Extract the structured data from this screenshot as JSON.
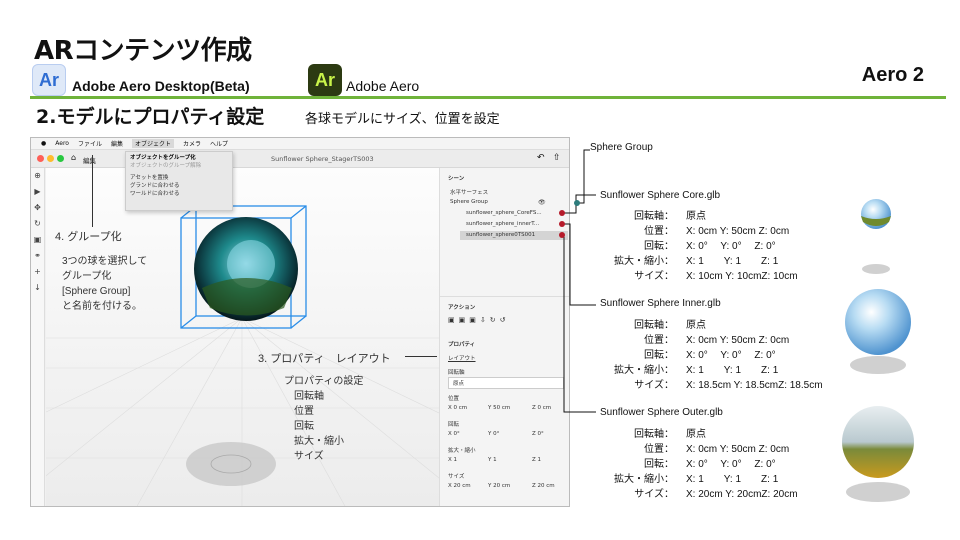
{
  "header": {
    "title": "ARコンテンツ作成",
    "app1_logo": "Ar",
    "app1_name": "Adobe Aero Desktop(Beta)",
    "app2_logo": "Ar",
    "app2_name": "Adobe Aero",
    "badge": "Aero 2",
    "accent": "#6fb33a"
  },
  "section": {
    "title": "2.モデルにプロパティ設定",
    "description": "各球モデルにサイズ、位置を設定"
  },
  "screenshot": {
    "menubar": [
      "Aero",
      "ファイル",
      "編集",
      "オブジェクト",
      "カメラ",
      "ヘルプ"
    ],
    "window_title": "Sunflower Sphere_StagerTS003",
    "breadcrumb": "編集",
    "dropdown": [
      "オブジェクトをグループ化",
      "オブジェクトのグループ解除",
      "アセットを置換",
      "グランドに合わせる",
      "ワールドに合わせる"
    ],
    "scene_header": "シーン",
    "scene_items": [
      "水平サーフェス",
      "Sphere Group",
      "sunflower_sphere_CoreFS...",
      "sunflower_sphere_innerT...",
      "sunflower_sphere0TS001"
    ],
    "action_header": "アクション",
    "property_header": "プロパティ",
    "layout_tab": "レイアウト",
    "pivot_label": "回転軸",
    "pivot_value": "原点",
    "position_label": "位置",
    "position_values": [
      "X 0 cm",
      "Y 50 cm",
      "Z 0 cm"
    ],
    "rotation_label": "回転",
    "rotation_values": [
      "X 0°",
      "Y 0°",
      "Z 0°"
    ],
    "scale_label": "拡大・縮小",
    "scale_values": [
      "X 1",
      "Y 1",
      "Z 1"
    ],
    "size_label": "サイズ",
    "size_values": [
      "X 20 cm",
      "Y 20 cm",
      "Z 20 cm"
    ]
  },
  "annotations": {
    "group_title": "4. グループ化",
    "group_desc": [
      "3つの球を選択して",
      "グループ化",
      "[Sphere Group]",
      "と名前を付ける。"
    ],
    "prop_title": "3. プロパティ　レイアウト",
    "prop_list": [
      "プロパティの設定",
      "回転軸",
      "位置",
      "回転",
      "拡大・縮小",
      "サイズ"
    ]
  },
  "sphere_group_label": "Sphere Group",
  "models": [
    {
      "name": "Sunflower Sphere Core.glb",
      "rows": [
        {
          "k": "回転軸：",
          "v": "原点"
        },
        {
          "k": "位置：",
          "v": "X: 0cm Y: 50cm Z: 0cm"
        },
        {
          "k": "回転：",
          "v": "X: 0°　 Y: 0°　 Z: 0°"
        },
        {
          "k": "拡大・縮小：",
          "v": "X: 1　　Y: 1　　Z: 1"
        },
        {
          "k": "サイズ：",
          "v": "X: 10cm Y: 10cmZ: 10cm"
        }
      ]
    },
    {
      "name": "Sunflower Sphere Inner.glb",
      "rows": [
        {
          "k": "回転軸：",
          "v": "原点"
        },
        {
          "k": "位置：",
          "v": "X: 0cm Y: 50cm Z: 0cm"
        },
        {
          "k": "回転：",
          "v": "X: 0°　 Y: 0°　 Z: 0°"
        },
        {
          "k": "拡大・縮小：",
          "v": "X: 1　　Y: 1　　Z: 1"
        },
        {
          "k": "サイズ：",
          "v": "X: 18.5cm Y: 18.5cmZ: 18.5cm"
        }
      ]
    },
    {
      "name": "Sunflower Sphere Outer.glb",
      "rows": [
        {
          "k": "回転軸：",
          "v": "原点"
        },
        {
          "k": "位置：",
          "v": "X: 0cm Y: 50cm Z: 0cm"
        },
        {
          "k": "回転：",
          "v": "X: 0°　 Y: 0°　 Z: 0°"
        },
        {
          "k": "拡大・縮小：",
          "v": "X: 1　　Y: 1　　Z: 1"
        },
        {
          "k": "サイズ：",
          "v": "X: 20cm Y: 20cmZ: 20cm"
        }
      ]
    }
  ]
}
